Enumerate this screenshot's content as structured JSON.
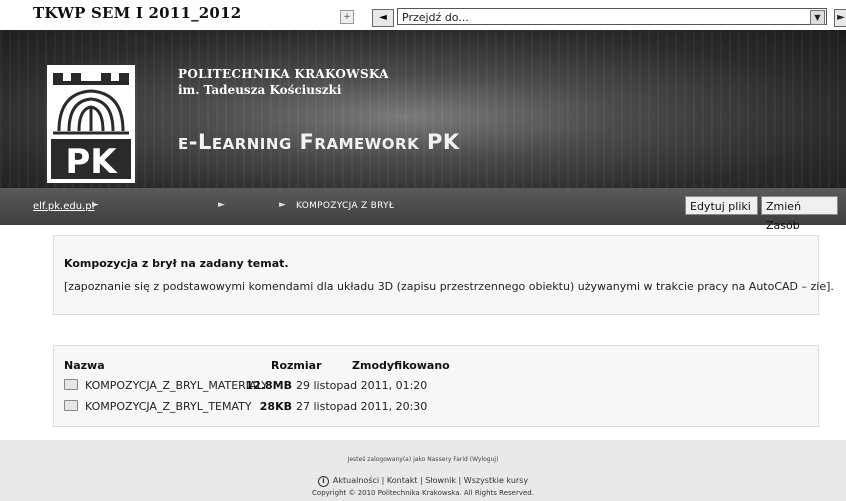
{
  "course": {
    "title": "TKWP SEM I 2011_2012"
  },
  "jump": {
    "prev": "◄",
    "next": "►",
    "value": "Przejdź do...",
    "arrow": "▼",
    "fold": "+"
  },
  "banner": {
    "university": "POLITECHNIKA KRAKOWSKA",
    "subtitle": "im. Tadeusza Kościuszki",
    "elf": "e-Learning Framework PK",
    "logo_text": "PK"
  },
  "nav": {
    "home": "elf.pk.edu.pl",
    "separator": "►",
    "current": "KOMPOZYCJA Z BRYŁ",
    "edit_button": "Edytuj pliki",
    "change_button": "Zmień Zasób"
  },
  "description": {
    "title": "Kompozycja z brył na zadany temat.",
    "text": "[zapoznanie się z podstawowymi komendami dla układu 3D (zapisu przestrzennego obiektu) używanymi w trakcie pracy na AutoCAD – zie]."
  },
  "files": {
    "headers": {
      "name": "Nazwa",
      "size": "Rozmiar",
      "modified": "Zmodyfikowano"
    },
    "rows": [
      {
        "name": "KOMPOZYCJA_Z_BRYL_MATERIALY",
        "size": "12.8MB",
        "date": "29 listopad 2011, 01:20"
      },
      {
        "name": "KOMPOZYCJA_Z_BRYL_TEMATY",
        "size": "28KB",
        "date": "27 listopad 2011, 20:30"
      }
    ]
  },
  "footer": {
    "login_info": "Jesteś zalogowany(a) jako Nassery Farid (Wyloguj)",
    "links": "Aktualności | Kontakt | Słownik | Wszystkie kursy",
    "info_icon": "i",
    "copyright": "Copyright © 2010 Politechnika Krakowska. All Rights Reserved."
  }
}
